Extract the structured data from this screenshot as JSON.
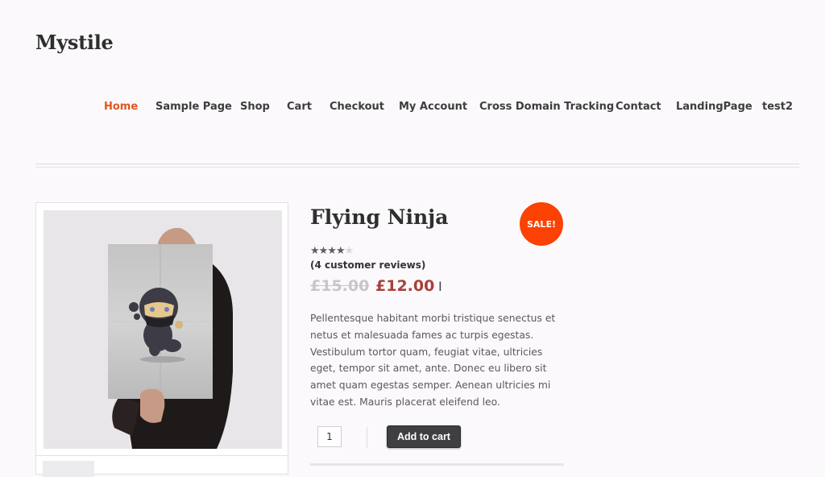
{
  "site": {
    "logo": "Mystile"
  },
  "nav": {
    "items": [
      {
        "label": "Home",
        "active": true
      },
      {
        "label": "Sample Page"
      },
      {
        "label": "Shop"
      },
      {
        "label": "Cart"
      },
      {
        "label": "Checkout"
      },
      {
        "label": "My Account"
      },
      {
        "label": "Cross Domain Tracking"
      },
      {
        "label": "Contact"
      },
      {
        "label": "LandingPage"
      },
      {
        "label": "test2"
      }
    ]
  },
  "product": {
    "title": "Flying Ninja",
    "sale_badge": "SALE!",
    "rating": {
      "value": 4,
      "max": 5,
      "stars_on": "★★★★",
      "stars_off": "★"
    },
    "reviews_text": "(4 customer reviews)",
    "price_old": "£15.00",
    "price_new": "£12.00",
    "description": "Pellentesque habitant morbi tristique senectus et netus et malesuada fames ac turpis egestas. Vestibulum tortor quam, feugiat vitae, ultricies eget, tempor sit amet, ante. Donec eu libero sit amet quam egestas semper. Aenean ultricies mi vitae est. Mauris placerat eleifend leo.",
    "quantity": "1",
    "add_to_cart_label": "Add to cart",
    "image_alt": "Flying Ninja poster"
  },
  "cursor": {
    "glyph": "I"
  },
  "colors": {
    "accent": "#e2561b",
    "sale": "#fb4204",
    "price": "#a8403b"
  }
}
